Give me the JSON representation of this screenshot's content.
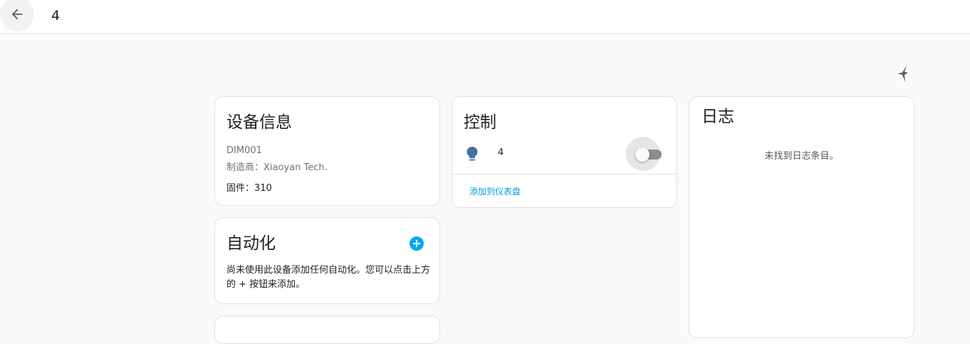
{
  "header": {
    "title": "4",
    "back_icon": "arrow-left-icon"
  },
  "corner_icon": "assist-icon",
  "device_info": {
    "title": "设备信息",
    "model": "DIM001",
    "manufacturer": "制造商：Xiaoyan Tech.",
    "firmware": "固件：310"
  },
  "automation": {
    "title": "自动化",
    "empty_text": "尚未使用此设备添加任何自动化。您可以点击上方的 + 按钮来添加。",
    "add_icon": "plus-circle-icon"
  },
  "controls": {
    "title": "控制",
    "entity": {
      "name": "4",
      "icon": "lightbulb-icon",
      "state": "off"
    },
    "add_to_dashboard": "添加到仪表盘"
  },
  "logbook": {
    "title": "日志",
    "empty_text": "未找到日志条目。"
  },
  "colors": {
    "accent": "#03a9f4",
    "link": "#039be5",
    "bulb": "#44739e"
  }
}
